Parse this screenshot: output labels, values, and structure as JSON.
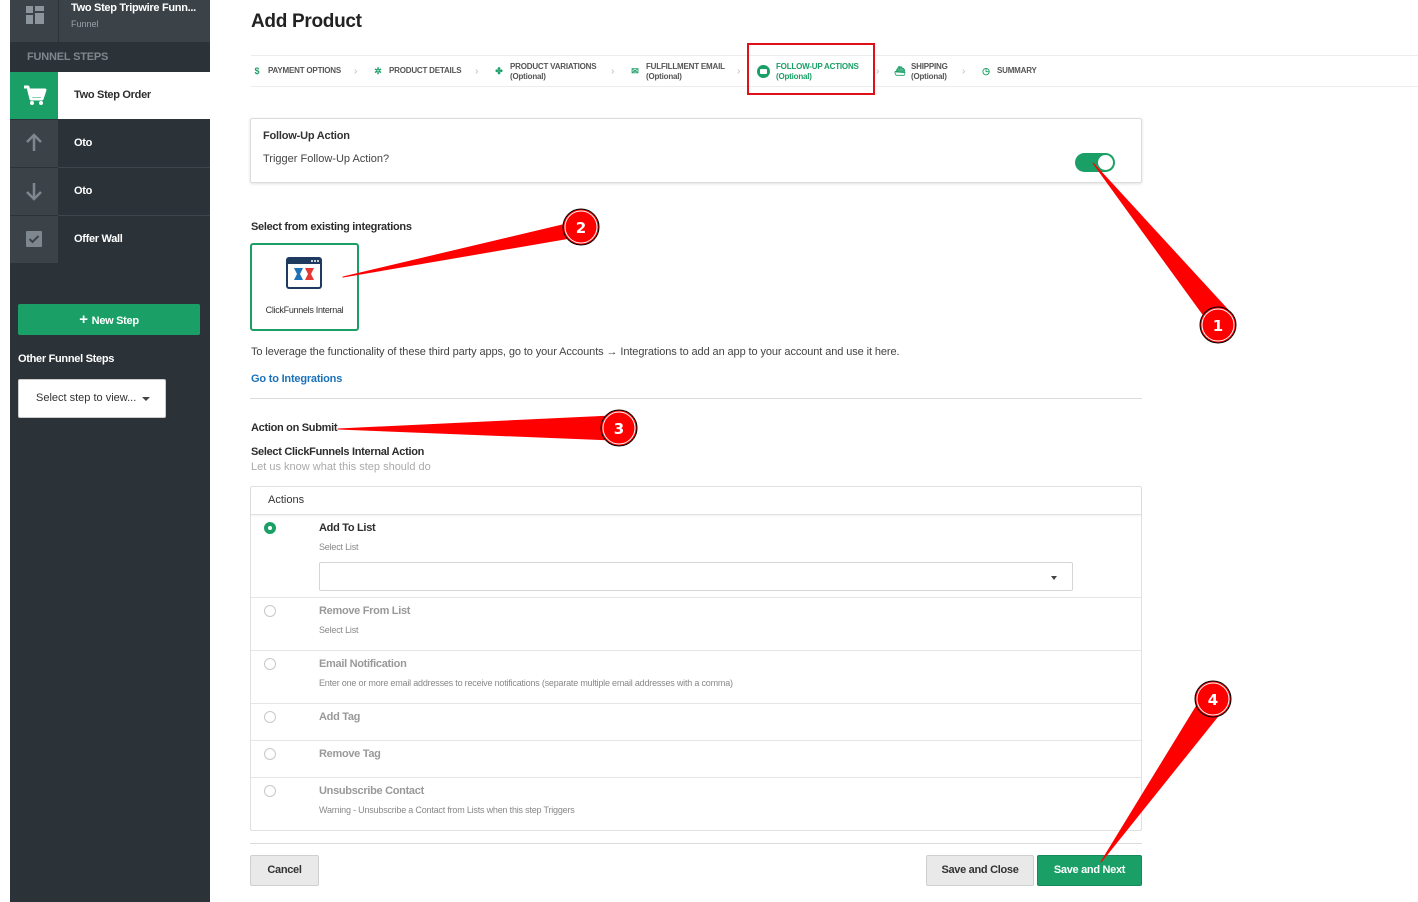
{
  "sidebar": {
    "funnel_title": "Two Step Tripwire Funn...",
    "funnel_subtitle": "Funnel",
    "steps_header": "FUNNEL STEPS",
    "steps": [
      {
        "label": "Two Step Order",
        "icon": "cart-icon",
        "active": true
      },
      {
        "label": "Oto",
        "icon": "arrow-up-icon"
      },
      {
        "label": "Oto",
        "icon": "arrow-down-icon"
      },
      {
        "label": "Offer Wall",
        "icon": "checkbox-icon"
      }
    ],
    "new_step_label": "New Step",
    "other_steps_label": "Other Funnel Steps",
    "select_placeholder": "Select step to view..."
  },
  "page": {
    "title": "Add Product"
  },
  "wizard": {
    "steps": [
      {
        "label": "PAYMENT OPTIONS",
        "optional": "",
        "icon": "dollar-icon"
      },
      {
        "label": "PRODUCT DETAILS",
        "optional": "",
        "icon": "gears-icon"
      },
      {
        "label": "PRODUCT VARIATIONS",
        "optional": "(Optional)",
        "icon": "variations-icon"
      },
      {
        "label": "FULFILLMENT EMAIL",
        "optional": "(Optional)",
        "icon": "envelope-icon"
      },
      {
        "label": "FOLLOW-UP ACTIONS",
        "optional": "(Optional)",
        "icon": "follow-up-icon",
        "active": true
      },
      {
        "label": "SHIPPING",
        "optional": "(Optional)",
        "icon": "ship-icon"
      },
      {
        "label": "SUMMARY",
        "optional": "",
        "icon": "clock-icon"
      }
    ]
  },
  "followup": {
    "heading": "Follow-Up Action",
    "question": "Trigger Follow-Up Action?",
    "enabled": true
  },
  "integrations": {
    "heading": "Select from existing integrations",
    "items": [
      {
        "name": "ClickFunnels Internal",
        "selected": true
      }
    ],
    "info_text": "To leverage the functionality of these third party apps, go to your Accounts → Integrations to add an app to your account and use it here.",
    "link_label": "Go to Integrations"
  },
  "submit": {
    "heading": "Action on Submit",
    "select_label": "Select ClickFunnels Internal Action",
    "hint": "Let us know what this step should do",
    "actions_header": "Actions",
    "actions": [
      {
        "title": "Add To List",
        "desc": "Select List",
        "selected": true
      },
      {
        "title": "Remove From List",
        "desc": "Select List"
      },
      {
        "title": "Email Notification",
        "desc": "Enter one or more email addresses to receive notifications (separate multiple email addresses with a comma)"
      },
      {
        "title": "Add Tag",
        "desc": ""
      },
      {
        "title": "Remove Tag",
        "desc": ""
      },
      {
        "title": "Unsubscribe Contact",
        "desc": "Warning - Unsubscribe a Contact from Lists when this step Triggers"
      }
    ]
  },
  "footer": {
    "cancel": "Cancel",
    "save_close": "Save and Close",
    "save_next": "Save and Next"
  },
  "annotations": {
    "color": "#ff0000",
    "markers": [
      "1",
      "2",
      "3",
      "4"
    ]
  }
}
